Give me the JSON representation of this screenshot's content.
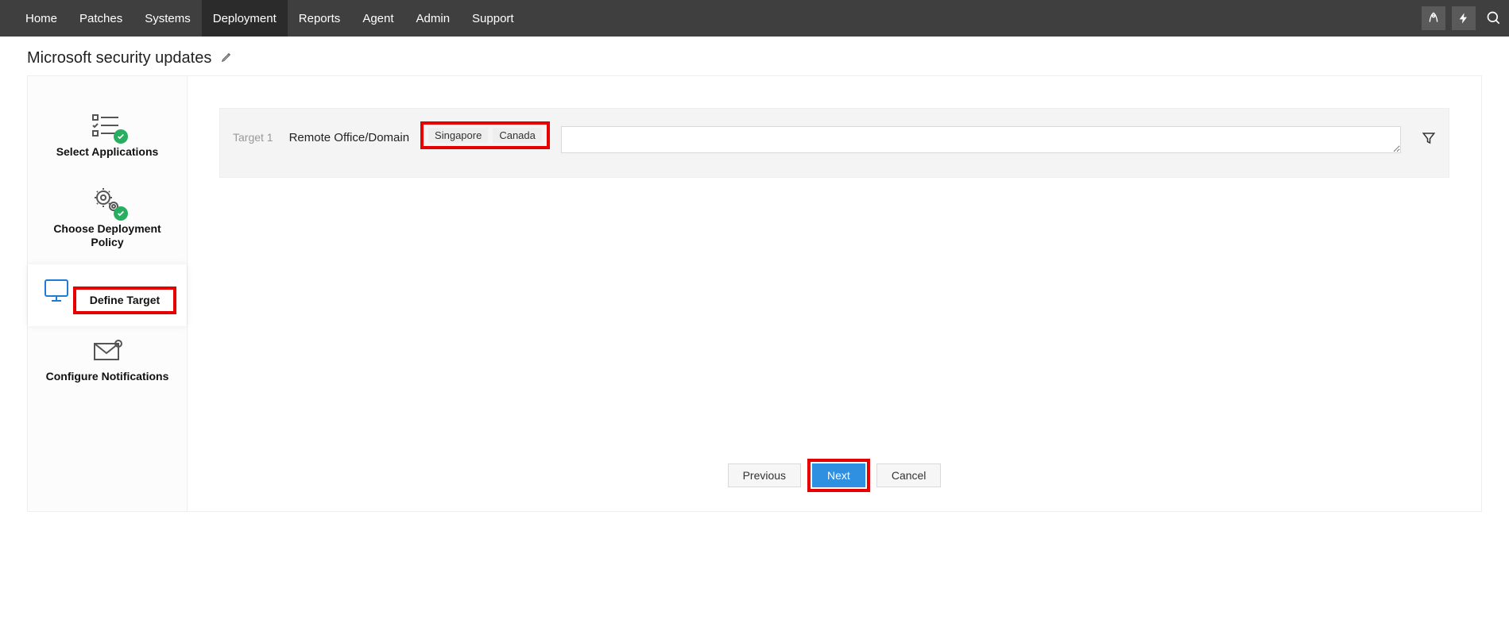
{
  "nav": {
    "items": [
      {
        "label": "Home"
      },
      {
        "label": "Patches"
      },
      {
        "label": "Systems"
      },
      {
        "label": "Deployment"
      },
      {
        "label": "Reports"
      },
      {
        "label": "Agent"
      },
      {
        "label": "Admin"
      },
      {
        "label": "Support"
      }
    ],
    "active_index": 3
  },
  "page": {
    "title": "Microsoft security updates"
  },
  "steps": [
    {
      "label": "Select Applications",
      "done": true
    },
    {
      "label": "Choose Deployment Policy",
      "done": true
    },
    {
      "label": "Define Target",
      "done": false,
      "active": true
    },
    {
      "label": "Configure Notifications",
      "done": false
    }
  ],
  "target": {
    "row_label": "Target 1",
    "field_label": "Remote Office/Domain",
    "chips": [
      "Singapore",
      "Canada"
    ]
  },
  "buttons": {
    "previous": "Previous",
    "next": "Next",
    "cancel": "Cancel"
  }
}
